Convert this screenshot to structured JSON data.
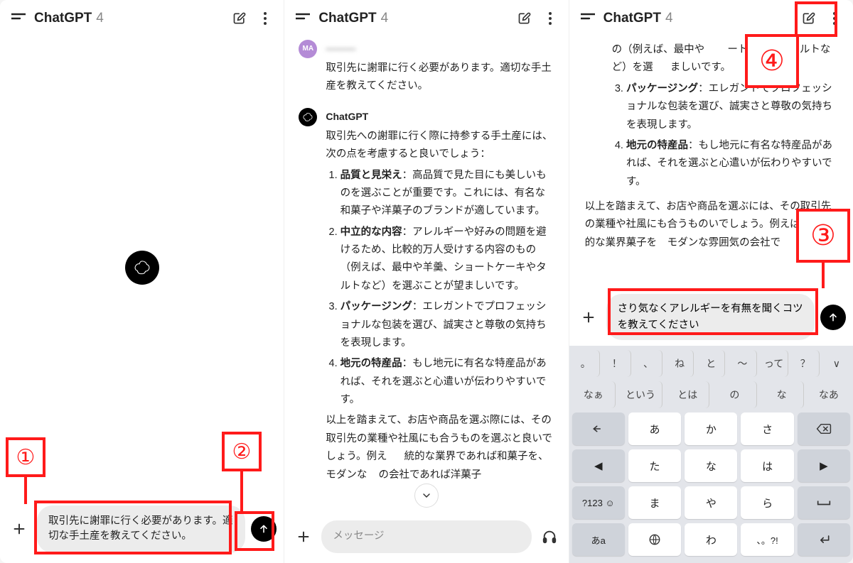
{
  "header": {
    "app_name": "ChatGPT",
    "version": "4"
  },
  "panel1": {
    "input_value": "取引先に謝罪に行く必要があります。適切な手土産を教えてください。"
  },
  "panel2": {
    "user_avatar_initials": "MA",
    "user_name_blurred": "———",
    "user_message": "取引先に謝罪に行く必要があります。適切な手土産を教えてください。",
    "assistant_name": "ChatGPT",
    "assistant_intro": "取引先への謝罪に行く際に持参する手土産には、次の点を考慮すると良いでしょう：",
    "points": [
      {
        "title": "品質と見栄え",
        "body": "：高品質で見た目にも美しいものを選ぶことが重要です。これには、有名な和菓子や洋菓子のブランドが適しています。"
      },
      {
        "title": "中立的な内容",
        "body": "：アレルギーや好みの問題を避けるため、比較的万人受けする内容のもの（例えば、最中や羊羹、ショートケーキやタルトなど）を選ぶことが望ましいです。"
      },
      {
        "title": "パッケージング",
        "body": "：エレガントでプロフェッショナルな包装を選び、誠実さと尊敬の気持ちを表現します。"
      },
      {
        "title": "地元の特産品",
        "body": "：もし地元に有名な特産品があれば、それを選ぶと心遣いが伝わりやすいです。"
      }
    ],
    "assistant_outro_a": "以上を踏まえて、お店や商品を選ぶ際には、その取引先の業種や社風にも合うものを選ぶと良いでしょう。例え",
    "assistant_outro_b": "統的な業界であれば和菓子を、モダンな",
    "assistant_outro_c": "の会社であれば洋菓子",
    "placeholder": "メッセージ"
  },
  "panel3": {
    "cont_line1": "の（例えば、最中や",
    "cont_line1b": "ートケーキやタルトなど）を選",
    "cont_line1c": "ましいです。",
    "points_rest": [
      {
        "n": "3",
        "title": "パッケージング",
        "body": "：エレガントでプロフェッショナルな包装を選び、誠実さと尊敬の気持ちを表現します。"
      },
      {
        "n": "4",
        "title": "地元の特産品",
        "body": "：もし地元に有名な特産品があれば、それを選ぶと心遣いが伝わりやすいです。"
      }
    ],
    "outro": "以上を踏まえて、お店や商品を選ぶには、その取引先の業種や社風にも合うものいでしょう。例えば、伝統的な業界菓子を　モダンな雰囲気の会社で",
    "input_value": "さり気なくアレルギーを有無を聞くコツを教えてください",
    "keyboard": {
      "suggestions_row1": [
        "。",
        "！",
        "、",
        "ね",
        "と",
        "〜",
        "って",
        "？",
        "∨"
      ],
      "suggestions_row2": [
        "なぁ",
        "という",
        "とは",
        "の",
        "な",
        "なあ"
      ],
      "rows": [
        [
          "↩",
          "あ",
          "か",
          "さ",
          "⌫"
        ],
        [
          "◀",
          "た",
          "な",
          "は",
          "▶"
        ],
        [
          "?123 ☺",
          "ま",
          "や",
          "ら",
          "␣"
        ],
        [
          "あa",
          "⊕",
          "わ",
          "、。?!",
          "↵"
        ]
      ]
    }
  },
  "annotations": {
    "1": "①",
    "2": "②",
    "3": "③",
    "4": "④"
  }
}
